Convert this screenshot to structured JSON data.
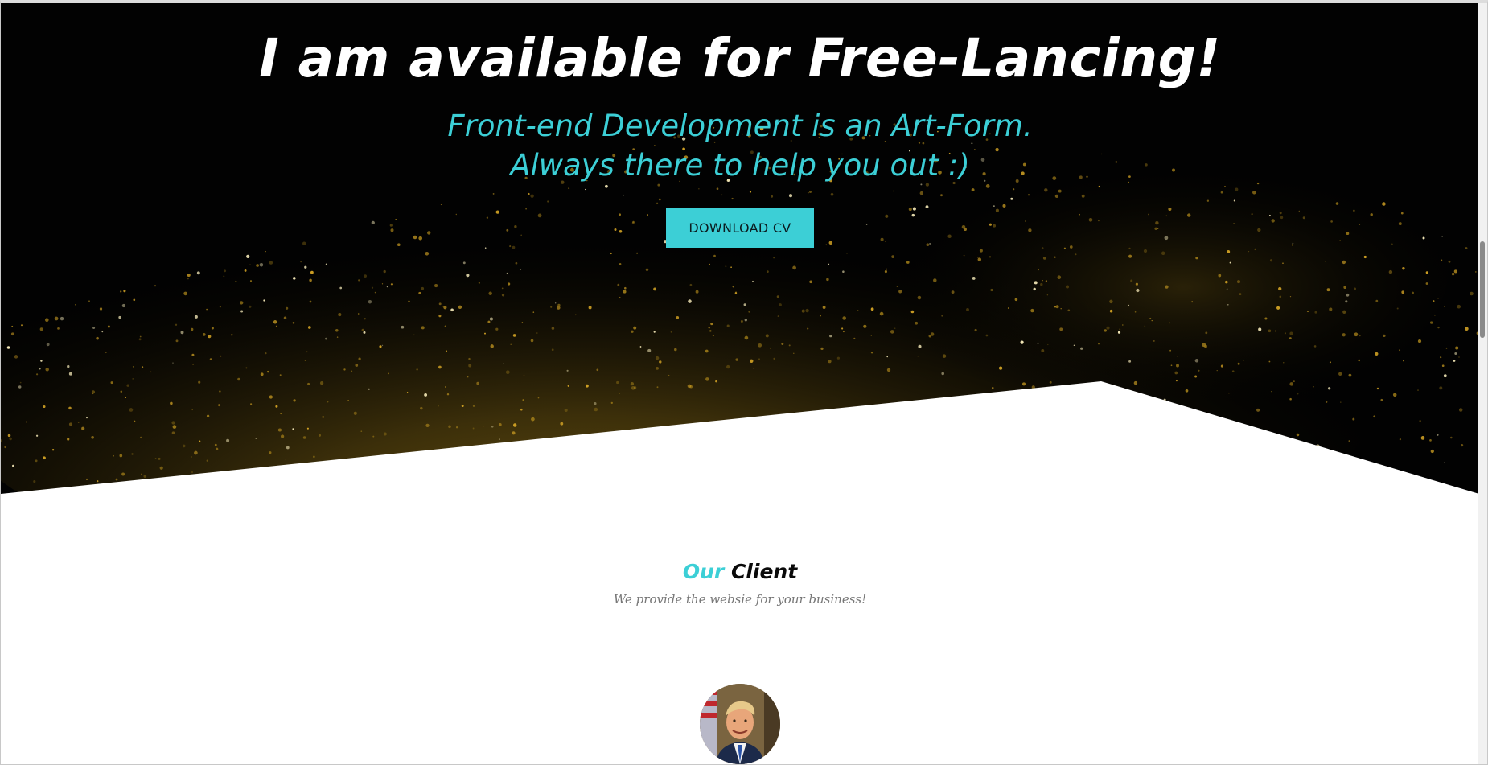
{
  "hero": {
    "title": "I am available for Free-Lancing!",
    "subtitle_line1": "Front-end Development is an Art-Form.",
    "subtitle_line2": "Always there to help you out :)",
    "cta_label": "DOWNLOAD CV",
    "background": "black-gold-glitter"
  },
  "client": {
    "title_accent": "Our",
    "title_main": "Client",
    "tagline": "We provide the websie for your business!",
    "avatar_icon": "client-portrait"
  },
  "colors": {
    "accent": "#3ccfd6",
    "hero_bg": "#000000",
    "title_text": "#ffffff",
    "tagline_text": "#777777"
  }
}
